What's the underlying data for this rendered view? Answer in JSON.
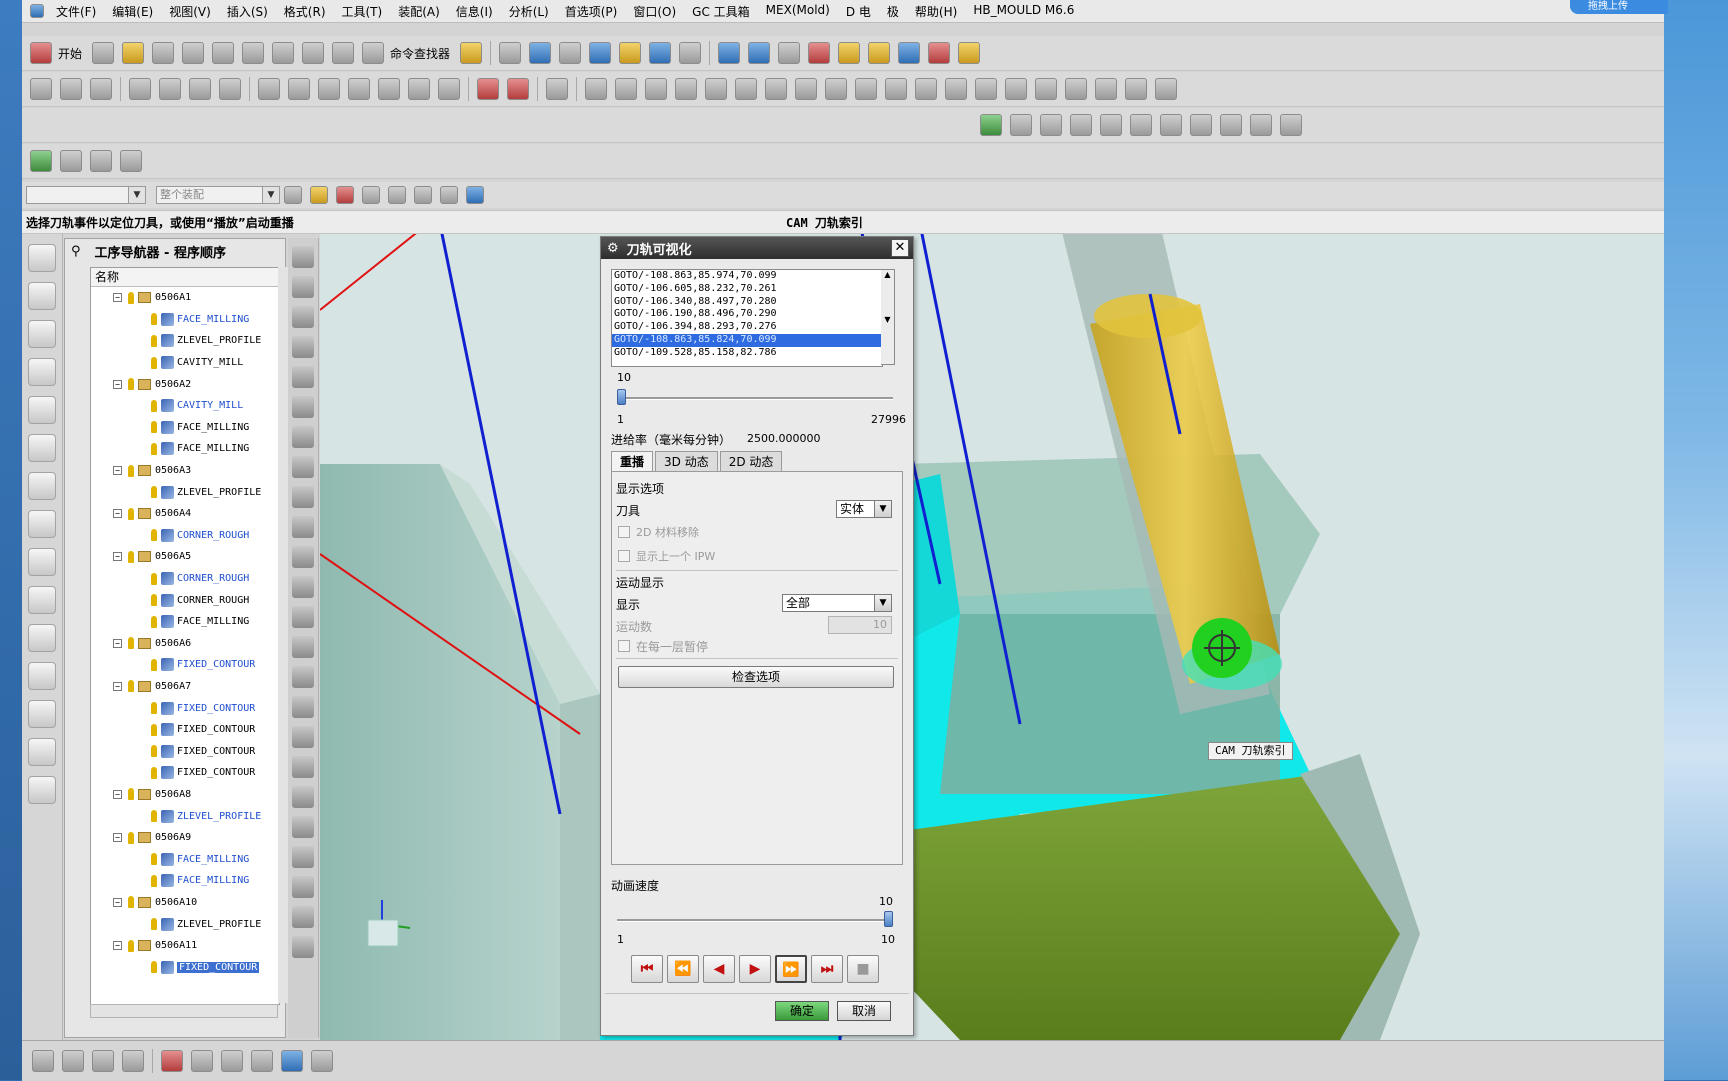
{
  "menu": [
    "文件(F)",
    "编辑(E)",
    "视图(V)",
    "插入(S)",
    "格式(R)",
    "工具(T)",
    "装配(A)",
    "信息(I)",
    "分析(L)",
    "首选项(P)",
    "窗口(O)",
    "GC 工具箱",
    "MEX(Mold)",
    "D 电",
    "极",
    "帮助(H)",
    "HB_MOULD M6.6"
  ],
  "toolbar": {
    "start_label": "开始",
    "command_finder_label": "命令查找器"
  },
  "selbar": {
    "filter_placeholder": "整个装配"
  },
  "status": {
    "prompt": "选择刀轨事件以定位刀具，或使用“播放”启动重播",
    "right_label": "CAM 刀轨索引"
  },
  "navigator": {
    "title": "工序导航器 - 程序顺序",
    "column_name": "名称",
    "rows": [
      {
        "type": "group",
        "name": "0506A1"
      },
      {
        "type": "op",
        "name": "FACE_MILLING",
        "style": "blue"
      },
      {
        "type": "op",
        "name": "ZLEVEL_PROFILE",
        "style": "normal"
      },
      {
        "type": "op",
        "name": "CAVITY_MILL",
        "style": "normal"
      },
      {
        "type": "group",
        "name": "0506A2"
      },
      {
        "type": "op",
        "name": "CAVITY_MILL",
        "style": "blue"
      },
      {
        "type": "op",
        "name": "FACE_MILLING",
        "style": "normal"
      },
      {
        "type": "op",
        "name": "FACE_MILLING",
        "style": "normal"
      },
      {
        "type": "group",
        "name": "0506A3"
      },
      {
        "type": "op",
        "name": "ZLEVEL_PROFILE",
        "style": "normal"
      },
      {
        "type": "group",
        "name": "0506A4"
      },
      {
        "type": "op",
        "name": "CORNER_ROUGH",
        "style": "blue"
      },
      {
        "type": "group",
        "name": "0506A5"
      },
      {
        "type": "op",
        "name": "CORNER_ROUGH",
        "style": "blue"
      },
      {
        "type": "op",
        "name": "CORNER_ROUGH",
        "style": "normal"
      },
      {
        "type": "op",
        "name": "FACE_MILLING",
        "style": "normal"
      },
      {
        "type": "group",
        "name": "0506A6"
      },
      {
        "type": "op",
        "name": "FIXED_CONTOUR",
        "style": "blue"
      },
      {
        "type": "group",
        "name": "0506A7"
      },
      {
        "type": "op",
        "name": "FIXED_CONTOUR",
        "style": "blue"
      },
      {
        "type": "op",
        "name": "FIXED_CONTOUR",
        "style": "normal"
      },
      {
        "type": "op",
        "name": "FIXED_CONTOUR",
        "style": "normal"
      },
      {
        "type": "op",
        "name": "FIXED_CONTOUR",
        "style": "normal"
      },
      {
        "type": "group",
        "name": "0506A8"
      },
      {
        "type": "op",
        "name": "ZLEVEL_PROFILE",
        "style": "blue"
      },
      {
        "type": "group",
        "name": "0506A9"
      },
      {
        "type": "op",
        "name": "FACE_MILLING",
        "style": "blue"
      },
      {
        "type": "op",
        "name": "FACE_MILLING",
        "style": "blue"
      },
      {
        "type": "group",
        "name": "0506A10"
      },
      {
        "type": "op",
        "name": "ZLEVEL_PROFILE",
        "style": "normal"
      },
      {
        "type": "group",
        "name": "0506A11"
      },
      {
        "type": "op",
        "name": "FIXED_CONTOUR",
        "style": "selected"
      }
    ]
  },
  "dialog": {
    "title": "刀轨可视化",
    "goto_lines": [
      "GOTO/-108.863,85.974,70.099",
      "GOTO/-106.605,88.232,70.261",
      "GOTO/-106.340,88.497,70.280",
      "GOTO/-106.190,88.496,70.290",
      "GOTO/-106.394,88.293,70.276",
      "GOTO/-108.863,85.824,70.099",
      "GOTO/-109.528,85.158,82.786"
    ],
    "selected_line": 5,
    "slider_label": "10",
    "slider_min": "1",
    "slider_max": "27996",
    "slider_fraction": 0.0,
    "feed_label": "进给率（毫米每分钟）",
    "feed_value": "2500.000000",
    "tabs": [
      "重播",
      "3D 动态",
      "2D 动态"
    ],
    "active_tab": 0,
    "display_options": "显示选项",
    "tool_label": "刀具",
    "tool_value": "实体",
    "opt_2d_material": "2D 材料移除",
    "opt_prev_ipw": "显示上一个 IPW",
    "motion_display": "运动显示",
    "display_label": "显示",
    "display_value": "全部",
    "motion_count_label": "运动数",
    "motion_count_value": "10",
    "pause_each_layer": "在每一层暂停",
    "check_options": "检查选项",
    "anim_speed": "动画速度",
    "speed_max_label": "10",
    "speed_min": "1",
    "speed_max": "10",
    "speed_fraction": 1.0,
    "ok": "确定",
    "cancel": "取消"
  },
  "viewport": {
    "cam_label": "CAM 刀轨索引"
  },
  "top_right_badge": "拖拽上传"
}
